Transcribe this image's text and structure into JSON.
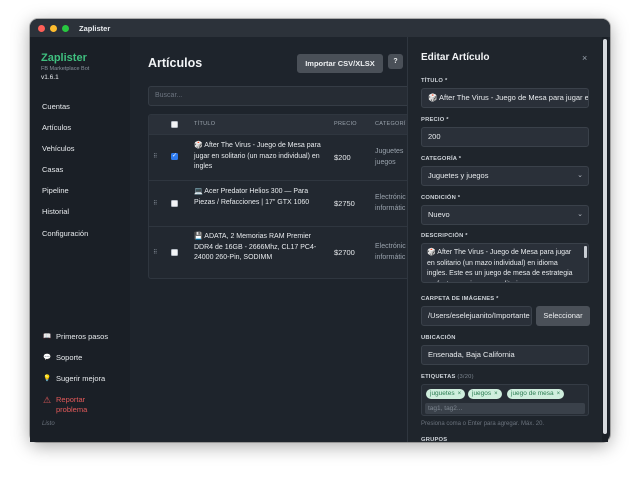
{
  "window": {
    "title": "Zaplister",
    "colors": {
      "close": "#ff5f57",
      "minimize": "#febc2e",
      "zoom": "#28c840",
      "accent": "#3fbf7f",
      "danger": "#e55a5a"
    }
  },
  "sidebar": {
    "brand": "Zaplister",
    "subtitle": "FB Marketplace Bot",
    "version": "v1.6.1",
    "nav": [
      "Cuentas",
      "Artículos",
      "Vehículos",
      "Casas",
      "Pipeline",
      "Historial",
      "Configuración"
    ],
    "footer": {
      "guide": {
        "icon": "book-icon",
        "label": "Primeros pasos"
      },
      "support": {
        "icon": "chat-icon",
        "label": "Soporte"
      },
      "suggest": {
        "icon": "lightbulb-icon",
        "label": "Sugerir mejora"
      },
      "report_line1": "Reportar",
      "report_line2": "problema"
    },
    "status": "Listo"
  },
  "main": {
    "title": "Artículos",
    "import_label": "Importar CSV/XLSX",
    "help_label": "?",
    "search_placeholder": "Buscar...",
    "columns": {
      "title": "TÍTULO",
      "price": "PRECIO",
      "category": "CATEGORÍ"
    },
    "rows": [
      {
        "checked": true,
        "title": "🎲 After The Virus - Juego de Mesa para jugar en solitario (un mazo individual) en ingles",
        "price": "$200",
        "category_1": "Juguetes",
        "category_2": "juegos"
      },
      {
        "checked": false,
        "title": "💻 Acer Predator Helios 300 — Para Piezas / Refacciones | 17\" GTX 1060",
        "price": "$2750",
        "category_1": "Electrónic",
        "category_2": "informátic"
      },
      {
        "checked": false,
        "title": "💾 ADATA, 2 Memorias RAM Premier DDR4 de 16GB - 2666Mhz, CL17 PC4-24000 260-Pin, SODIMM",
        "price": "$2700",
        "category_1": "Electrónic",
        "category_2": "informátic"
      }
    ]
  },
  "panel": {
    "title": "Editar Artículo",
    "close": "×",
    "labels": {
      "title": "TÍTULO *",
      "price": "PRECIO *",
      "category": "CATEGORÍA *",
      "condition": "CONDICIÓN *",
      "description": "DESCRIPCIÓN *",
      "images": "CARPETA DE IMÁGENES *",
      "location": "UBICACIÓN",
      "tags": "ETIQUETAS",
      "tags_count": "(3/20)",
      "groups": "GRUPOS"
    },
    "title_value": "🎲 After The Virus - Juego de Mesa para jugar en solitario",
    "price_value": "200",
    "category_value": "Juguetes y juegos",
    "condition_value": "Nuevo",
    "description_value": "🎲 After The Virus - Juego de Mesa para jugar en solitario (un mazo individual) en idioma ingles. Este es un juego de mesa de estrategia perfecto para jugar en solitario.",
    "images_value": "/Users/eselejuanito/Importante",
    "browse_label": "Seleccionar",
    "location_value": "Ensenada, Baja California",
    "tags": [
      "juguetes",
      "juegos",
      "juego de mesa"
    ],
    "tag_placeholder": "tag1, tag2...",
    "tags_hint": "Presiona coma o Enter para agregar. Máx. 20."
  }
}
